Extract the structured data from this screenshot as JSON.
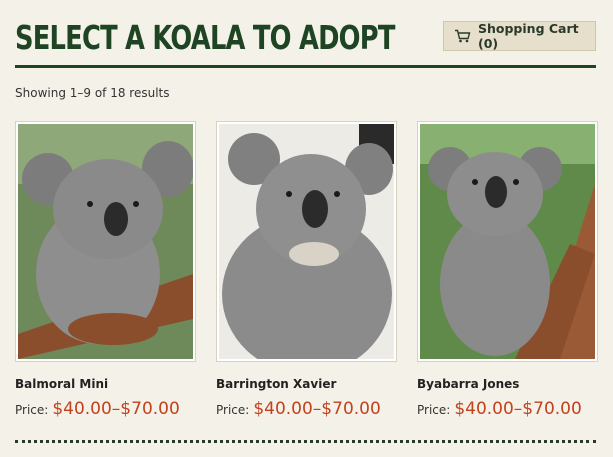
{
  "page": {
    "title": "SELECT A KOALA TO ADOPT",
    "result_count": "Showing 1–9 of 18 results"
  },
  "cart": {
    "label": "Shopping Cart (0)",
    "icon": "shopping-cart-icon"
  },
  "products": [
    {
      "name": "Balmoral Mini",
      "price_label": "Price:",
      "price": "$40.00–$70.00"
    },
    {
      "name": "Barrington Xavier",
      "price_label": "Price:",
      "price": "$40.00–$70.00"
    },
    {
      "name": "Byabarra Jones",
      "price_label": "Price:",
      "price": "$40.00–$70.00"
    }
  ],
  "colors": {
    "title_green": "#1e4424",
    "price_red": "#c2421e",
    "background": "#f4f1e8",
    "cart_button": "#e6dfcb"
  }
}
